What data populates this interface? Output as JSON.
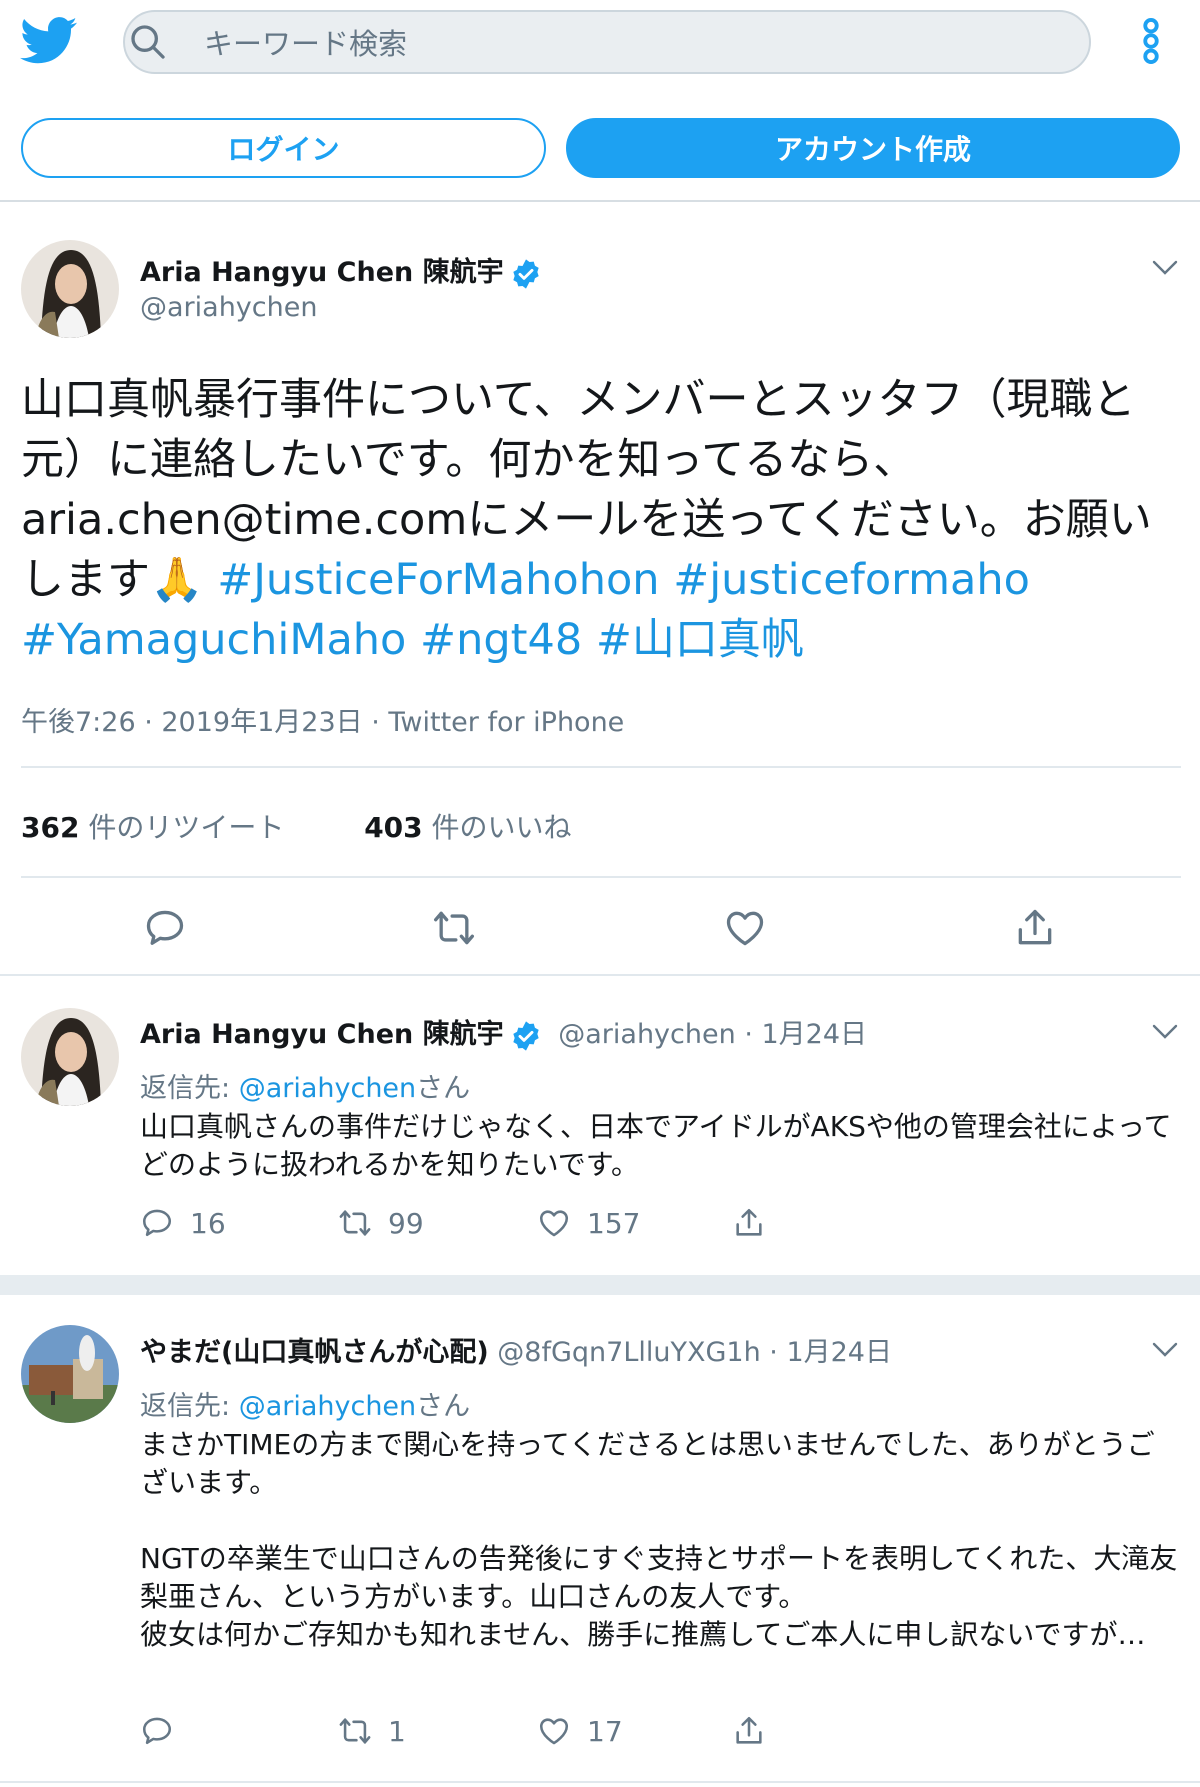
{
  "header": {
    "search_placeholder": "キーワード検索",
    "login_label": "ログイン",
    "signup_label": "アカウント作成"
  },
  "colors": {
    "accent": "#1da1f2",
    "link": "#1b95e0",
    "muted": "#657786"
  },
  "main_tweet": {
    "name": "Aria Hangyu Chen 陳航宇",
    "handle": "@ariahychen",
    "text_plain": "山口真帆暴行事件について、メンバーとスッタフ（現職と元）に連絡したいです。何かを知ってるなら、aria.chen@time.comにメールを送ってください。お願いします",
    "emoji": "🙏",
    "hashtags": [
      "#JusticeForMahohon",
      "#justiceformaho",
      "#YamaguchiMaho",
      "#ngt48",
      "#山口真帆"
    ],
    "meta": "午後7:26 · 2019年1月23日 · Twitter for iPhone",
    "retweet_count": "362",
    "retweet_label": "件のリツイート",
    "like_count": "403",
    "like_label": "件のいいね"
  },
  "replies": [
    {
      "name": "Aria Hangyu Chen 陳航宇",
      "verified": true,
      "handle": "@ariahychen",
      "date": "· 1月24日",
      "reply_to_prefix": "返信先: ",
      "reply_to_handle": "@ariahychen",
      "reply_to_suffix": "さん",
      "text": "山口真帆さんの事件だけじゃなく、日本でアイドルがAKSや他の管理会社によってどのように扱われるかを知りたいです。",
      "replies": "16",
      "retweets": "99",
      "likes": "157"
    },
    {
      "name": "やまだ(山口真帆さんが心配)",
      "verified": false,
      "handle": "@8fGqn7LlluYXG1h",
      "date": "· 1月24日",
      "reply_to_prefix": "返信先: ",
      "reply_to_handle": "@ariahychen",
      "reply_to_suffix": "さん",
      "text_p1": "まさかTIMEの方まで関心を持ってくださるとは思いませんでした、ありがとうございます。",
      "text_p2": "NGTの卒業生で山口さんの告発後にすぐ支持とサポートを表明してくれた、大滝友梨亜さん、という方がいます。山口さんの友人です。",
      "text_p3": "彼女は何かご存知かも知れません、勝手に推薦してご本人に申し訳ないですが…",
      "replies": "",
      "retweets": "1",
      "likes": "17"
    }
  ]
}
